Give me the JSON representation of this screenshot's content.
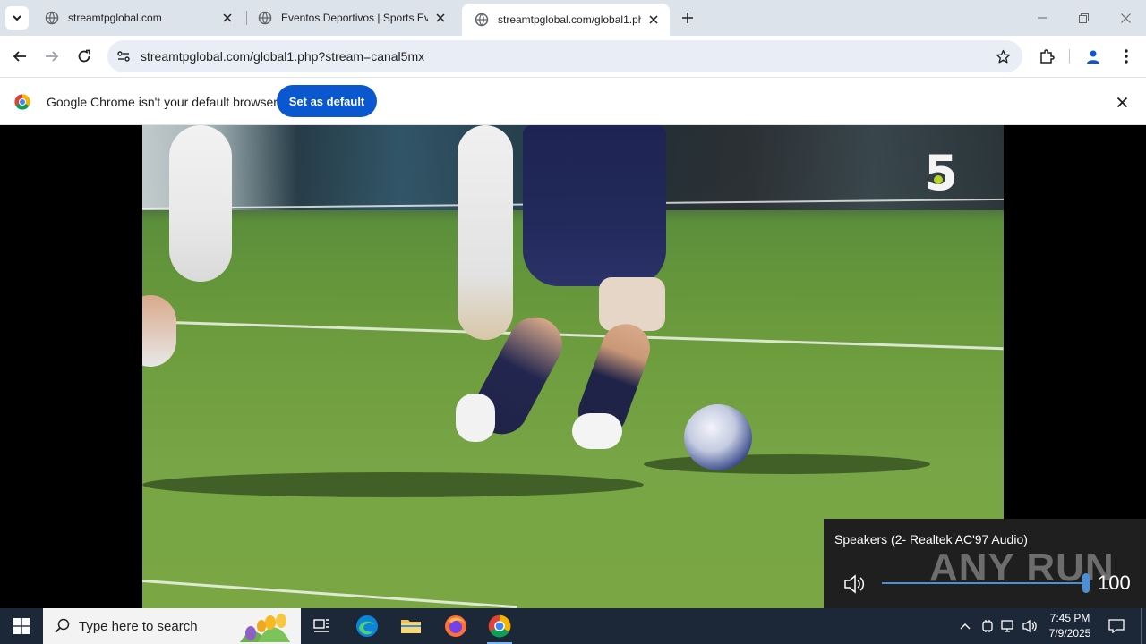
{
  "browser": {
    "tabs": [
      {
        "title": "streamtpglobal.com",
        "active": false
      },
      {
        "title": "Eventos Deportivos | Sports Eve",
        "active": false
      },
      {
        "title": "streamtpglobal.com/global1.ph",
        "active": true
      }
    ],
    "url": "streamtpglobal.com/global1.php?stream=canal5mx"
  },
  "infobar": {
    "message": "Google Chrome isn't your default browser",
    "button_label": "Set as default"
  },
  "video": {
    "channel_logo": "5"
  },
  "volume_flyout": {
    "device": "Speakers (2- Realtek AC'97 Audio)",
    "level": 100,
    "level_label": "100",
    "watermark": "ANY RUN"
  },
  "taskbar": {
    "search_placeholder": "Type here to search",
    "time": "7:45 PM",
    "date": "7/9/2025"
  },
  "colors": {
    "accent": "#0b57d0",
    "tabstrip": "#dde3ea",
    "taskbar": "#1c2838",
    "volume_accent": "#4a90d9"
  }
}
